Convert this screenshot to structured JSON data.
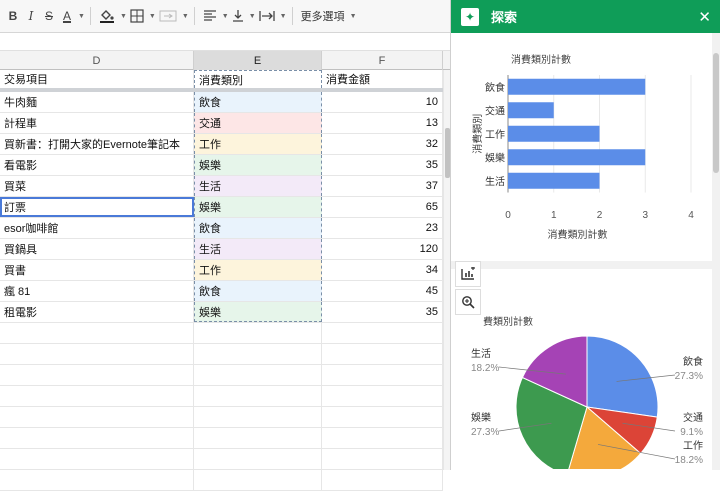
{
  "toolbar": {
    "bold": "B",
    "italic": "I",
    "strike": "S",
    "text_color": "A",
    "more_options": "更多選項"
  },
  "sheet": {
    "col_headers": [
      "D",
      "E",
      "F"
    ],
    "header": [
      "交易項目",
      "消費類別",
      "消費金額"
    ],
    "rows": [
      {
        "item": "牛肉麵",
        "category": "飲食",
        "amount": "10"
      },
      {
        "item": "計程車",
        "category": "交通",
        "amount": "13"
      },
      {
        "item": "買新書：打開大家的Evernote筆記本",
        "category": "工作",
        "amount": "32"
      },
      {
        "item": "看電影",
        "category": "娛樂",
        "amount": "35"
      },
      {
        "item": "買菜",
        "category": "生活",
        "amount": "37"
      },
      {
        "item": "訂票",
        "category": "娛樂",
        "amount": "65"
      },
      {
        "item": "esor咖啡館",
        "category": "飲食",
        "amount": "23"
      },
      {
        "item": "買鍋具",
        "category": "生活",
        "amount": "120"
      },
      {
        "item": "買書",
        "category": "工作",
        "amount": "34"
      },
      {
        "item": "瘋 81",
        "category": "飲食",
        "amount": "45"
      },
      {
        "item": "租電影",
        "category": "娛樂",
        "amount": "35"
      }
    ]
  },
  "panel": {
    "title": "探索",
    "accent": "#0f9d58"
  },
  "chart_data": [
    {
      "type": "bar",
      "title": "消費類別計數",
      "xlabel": "消費類別計數",
      "ylabel": "消費類別",
      "categories": [
        "飲食",
        "交通",
        "工作",
        "娛樂",
        "生活"
      ],
      "values": [
        3,
        1,
        2,
        3,
        2
      ],
      "xlim": [
        0,
        4
      ],
      "xticks": [
        "0",
        "1",
        "2",
        "3",
        "4"
      ],
      "color": "#5b8de8"
    },
    {
      "type": "pie",
      "title": "費類別計數",
      "slices": [
        {
          "label": "飲食",
          "pct": "27.3%",
          "value": 27.3,
          "color": "#5b8de8"
        },
        {
          "label": "交通",
          "pct": "9.1%",
          "value": 9.1,
          "color": "#dc4437"
        },
        {
          "label": "工作",
          "pct": "18.2%",
          "value": 18.2,
          "color": "#f4a93c"
        },
        {
          "label": "娛樂",
          "pct": "27.3%",
          "value": 27.3,
          "color": "#3d9a4f"
        },
        {
          "label": "生活",
          "pct": "18.2%",
          "value": 18.2,
          "color": "#a543b5"
        }
      ]
    }
  ]
}
